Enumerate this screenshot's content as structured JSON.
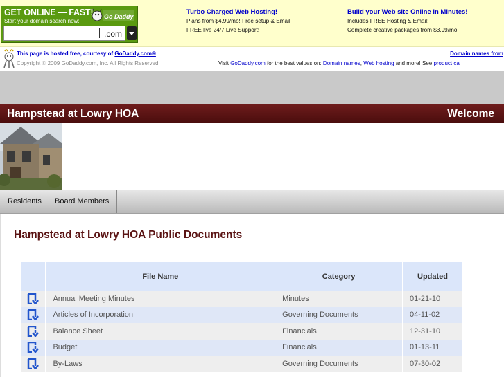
{
  "ad": {
    "promo_headline": "GET ONLINE — FAST!",
    "promo_sub": "Start your domain search now:",
    "logo_text": "Go Daddy",
    "tld": ".com",
    "col1": {
      "link": "Turbo Charged Web Hosting!",
      "line1": "Plans from $4.99/mo! Free setup & Email",
      "line2": "FREE live 24/7 Live Support!"
    },
    "col2": {
      "link": "Build your Web site Online in Minutes!",
      "line1": "Includes FREE Hosting & Email!",
      "line2": "Complete creative packages from $3.99/mo!"
    }
  },
  "hosted": {
    "line1_prefix": "This page is hosted free, courtesy of ",
    "line1_link": "GoDaddy.com®",
    "line2": "Copyright © 2009 GoDaddy.com, Inc. All Rights Reserved.",
    "right1": "Domain names from",
    "visit_prefix": "Visit ",
    "visit_link": "GoDaddy.com",
    "visit_mid": " for the best values on: ",
    "link_domains": "Domain names",
    "sep": ", ",
    "link_hosting": "Web hosting",
    "visit_tail": " and more! See ",
    "link_product": "product ca"
  },
  "site": {
    "title": "Hampstead at Lowry HOA",
    "welcome": "Welcome"
  },
  "nav": {
    "residents": "Residents",
    "board": "Board Members"
  },
  "content": {
    "heading": "Hampstead at Lowry HOA Public Documents",
    "columns": {
      "name": "File Name",
      "category": "Category",
      "updated": "Updated"
    },
    "rows": [
      {
        "name": "Annual Meeting Minutes",
        "category": "Minutes",
        "updated": "01-21-10"
      },
      {
        "name": "Articles of Incorporation",
        "category": "Governing Documents",
        "updated": "04-11-02"
      },
      {
        "name": "Balance Sheet",
        "category": "Financials",
        "updated": "12-31-10"
      },
      {
        "name": "Budget",
        "category": "Financials",
        "updated": "01-13-11"
      },
      {
        "name": "By-Laws",
        "category": "Governing Documents",
        "updated": "07-30-02"
      }
    ]
  },
  "colors": {
    "title_bar": "#5a1313",
    "heading": "#5a1313",
    "header_row": "#dbe6fa",
    "row_even": "#dfe7f7",
    "row_odd": "#eeeeee",
    "icon": "#2255cc",
    "link": "#0000cc",
    "promo": "#5a9a10"
  }
}
